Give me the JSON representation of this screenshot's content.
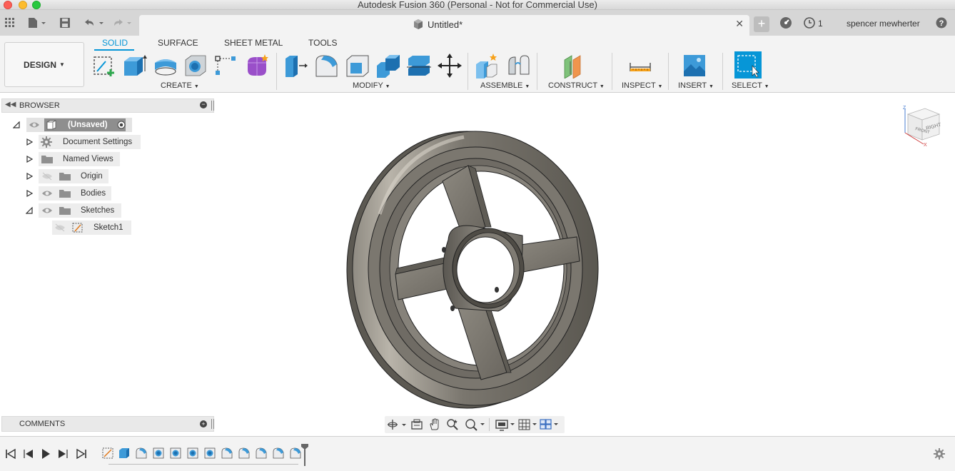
{
  "window": {
    "title": "Autodesk Fusion 360 (Personal - Not for Commercial Use)"
  },
  "tabbar": {
    "doc_tab_label": "Untitled*",
    "jobs_count": "1",
    "user_name": "spencer mewherter",
    "icons": [
      "grid-icon",
      "file-icon",
      "save-icon",
      "undo-icon",
      "redo-icon",
      "close-icon",
      "plus-icon",
      "gauge-icon",
      "clock-icon",
      "help-icon"
    ]
  },
  "toolbar": {
    "workspace_label": "DESIGN",
    "tabs": [
      "SOLID",
      "SURFACE",
      "SHEET METAL",
      "TOOLS"
    ],
    "active_tab": "SOLID",
    "groups": [
      "CREATE",
      "MODIFY",
      "ASSEMBLE",
      "CONSTRUCT",
      "INSPECT",
      "INSERT",
      "SELECT"
    ],
    "accent_color": "#0696d7"
  },
  "browser": {
    "title": "BROWSER",
    "root_label": "(Unsaved)",
    "items": [
      {
        "label": "Document Settings",
        "icon": "gear-icon"
      },
      {
        "label": "Named Views",
        "icon": "folder-icon"
      },
      {
        "label": "Origin",
        "icon": "folder-icon"
      },
      {
        "label": "Bodies",
        "icon": "folder-icon"
      },
      {
        "label": "Sketches",
        "icon": "folder-icon"
      },
      {
        "label": "Sketch1",
        "icon": "sketch-icon"
      }
    ]
  },
  "comments": {
    "title": "COMMENTS"
  },
  "viewcube": {
    "front_label": "FRONT",
    "right_label": "RIGHT",
    "axis_z": "Z",
    "axis_x": "X"
  }
}
